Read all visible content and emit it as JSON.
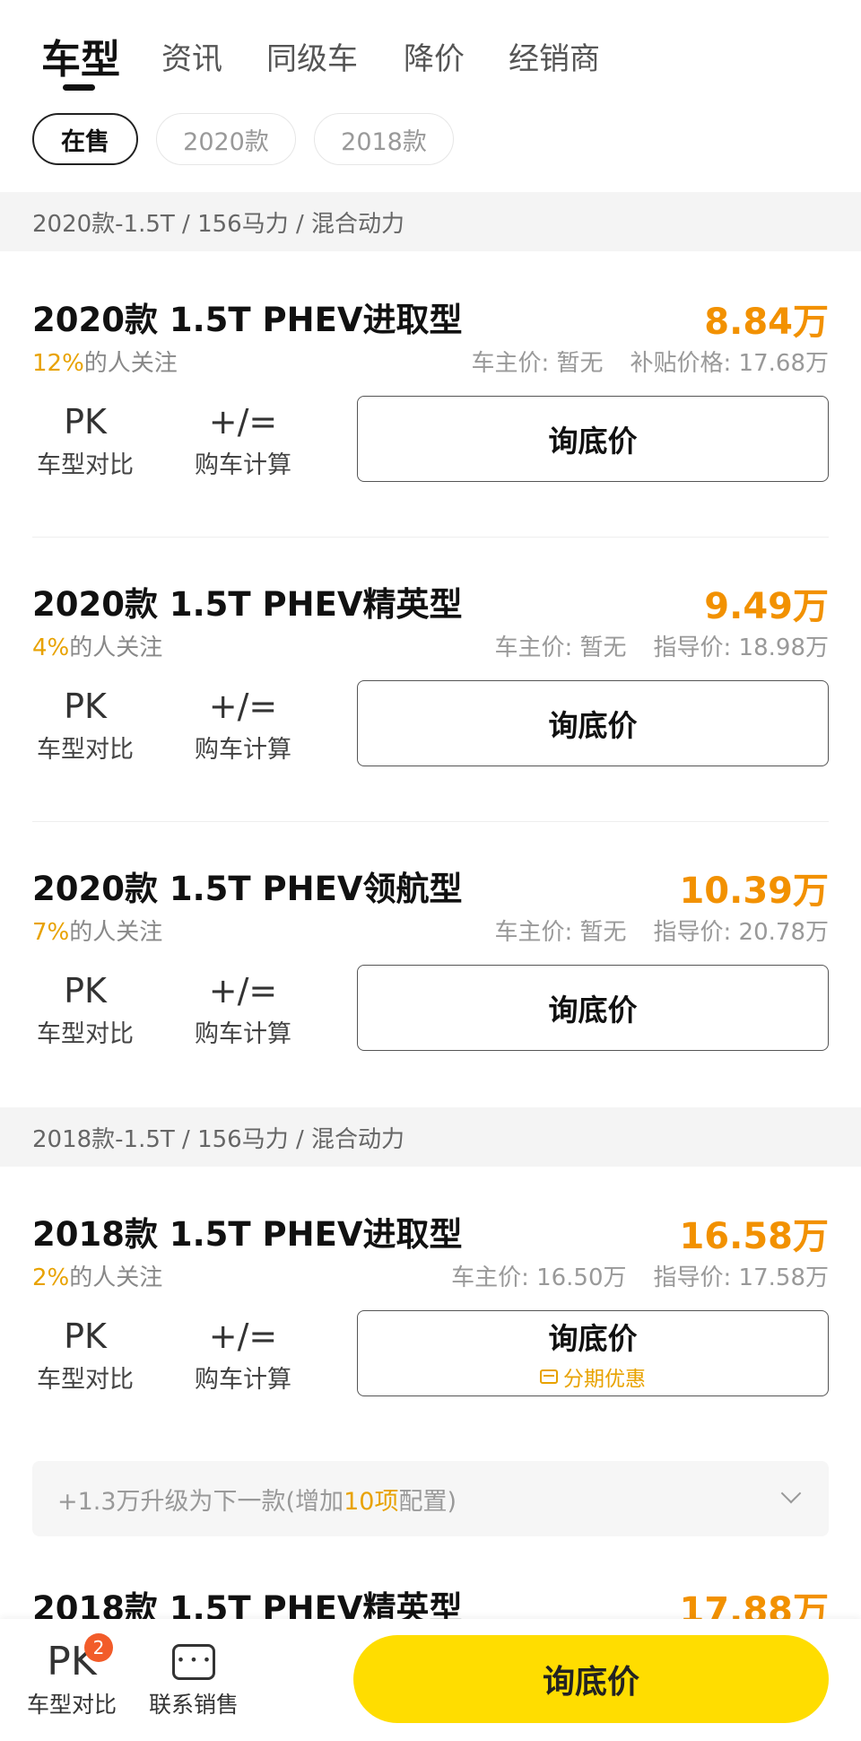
{
  "tabs": [
    "车型",
    "资讯",
    "同级车",
    "降价",
    "经销商"
  ],
  "filters": [
    "在售",
    "2020款",
    "2018款"
  ],
  "groups": [
    {
      "header": "2020款-1.5T / 156马力 / 混合动力"
    },
    {
      "header": "2018款-1.5T / 156马力 / 混合动力"
    }
  ],
  "cars": [
    {
      "name": "2020款 1.5T PHEV进取型",
      "price": "8.84万",
      "follow_pct": "12%",
      "follow_suffix": "的人关注",
      "owner_price": "车主价: 暂无",
      "ref_price": "补贴价格: 17.68万"
    },
    {
      "name": "2020款 1.5T PHEV精英型",
      "price": "9.49万",
      "follow_pct": "4%",
      "follow_suffix": "的人关注",
      "owner_price": "车主价: 暂无",
      "ref_price": "指导价: 18.98万"
    },
    {
      "name": "2020款 1.5T PHEV领航型",
      "price": "10.39万",
      "follow_pct": "7%",
      "follow_suffix": "的人关注",
      "owner_price": "车主价: 暂无",
      "ref_price": "指导价: 20.78万"
    },
    {
      "name": "2018款 1.5T PHEV进取型",
      "price": "16.58万",
      "follow_pct": "2%",
      "follow_suffix": "的人关注",
      "owner_price": "车主价: 16.50万",
      "ref_price": "指导价: 17.58万",
      "promo": "分期优惠"
    },
    {
      "name": "2018款 1.5T PHEV精英型",
      "price": "17.88万"
    }
  ],
  "actions": {
    "pk_glyph": "PK",
    "pk_label": "车型对比",
    "calc_glyph": "+/=",
    "calc_label": "购车计算",
    "ask_label": "询底价"
  },
  "upgrade": {
    "prefix": "+1.3万升级为下一款(增加",
    "highlight": "10项",
    "suffix": "配置)"
  },
  "bottom_bar": {
    "compare_glyph": "PK",
    "compare_label": "车型对比",
    "compare_badge": "2",
    "contact_label": "联系销售",
    "cta_label": "询底价"
  },
  "colors": {
    "accent": "#f29100",
    "cta": "#ffdd00",
    "badge": "#f25c2a"
  }
}
